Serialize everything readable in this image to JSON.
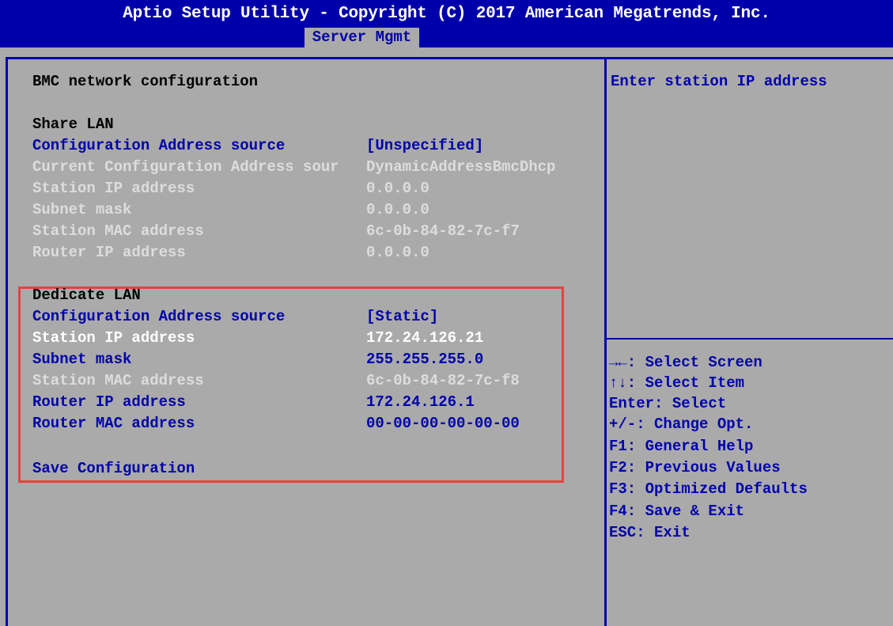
{
  "header": {
    "title": "Aptio Setup Utility - Copyright (C) 2017 American Megatrends, Inc.",
    "tab": "Server Mgmt"
  },
  "main": {
    "section_title": "BMC network configuration",
    "share_lan": {
      "heading": "Share LAN",
      "rows": [
        {
          "label": "Configuration Address source",
          "value": "[Unspecified]"
        },
        {
          "label": "Current Configuration Address sour",
          "value": "DynamicAddressBmcDhcp"
        },
        {
          "label": "Station IP address",
          "value": "0.0.0.0"
        },
        {
          "label": "Subnet mask",
          "value": "0.0.0.0"
        },
        {
          "label": "Station MAC address",
          "value": "6c-0b-84-82-7c-f7"
        },
        {
          "label": "Router IP address",
          "value": "0.0.0.0"
        }
      ]
    },
    "dedicate_lan": {
      "heading": "Dedicate LAN",
      "rows": [
        {
          "label": "Configuration Address source",
          "value": "[Static]"
        },
        {
          "label": "Station IP address",
          "value": "172.24.126.21"
        },
        {
          "label": "Subnet mask",
          "value": "255.255.255.0"
        },
        {
          "label": "Station MAC address",
          "value": "6c-0b-84-82-7c-f8"
        },
        {
          "label": "Router IP address",
          "value": "172.24.126.1"
        },
        {
          "label": "Router MAC address",
          "value": "00-00-00-00-00-00"
        }
      ],
      "save": "Save Configuration"
    }
  },
  "help": {
    "text": "Enter station IP address",
    "keys": [
      "→←: Select Screen",
      "↑↓: Select Item",
      "Enter: Select",
      "+/-: Change Opt.",
      "F1: General Help",
      "F2: Previous Values",
      "F3: Optimized Defaults",
      "F4: Save & Exit",
      "ESC: Exit"
    ]
  },
  "colors": {
    "background": "#aaaaaa",
    "bios_blue": "#0000aa",
    "selected_text": "#ffffff",
    "disabled_text": "#dddddd",
    "highlight_border": "#e8413e"
  }
}
